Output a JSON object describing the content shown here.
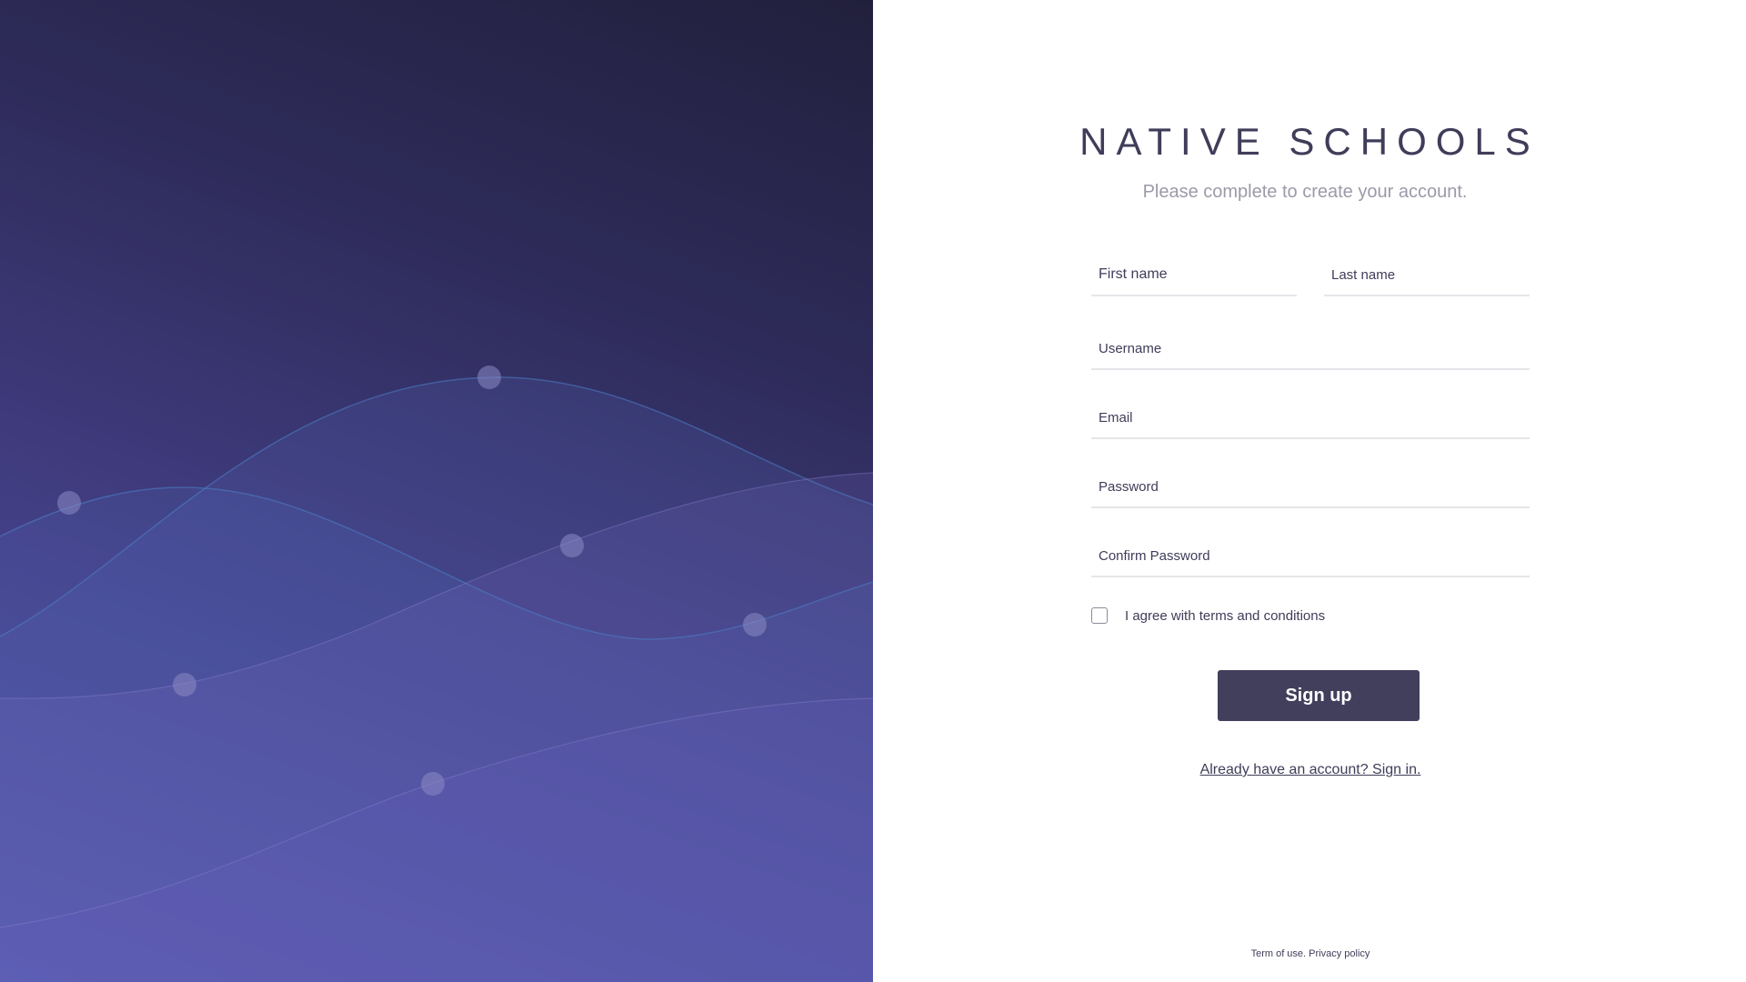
{
  "brand": {
    "title": "NATIVE SCHOOLS",
    "subtitle": "Please complete to create your account."
  },
  "form": {
    "first_name_placeholder": "First name",
    "last_name_placeholder": "Last name",
    "username_placeholder": "Username",
    "email_placeholder": "Email",
    "password_placeholder": "Password",
    "confirm_password_placeholder": "Confirm Password",
    "agree_label": "I agree with terms and conditions",
    "agree_checked": false,
    "signup_label": "Sign up",
    "signin_link": "Already have an account? Sign in."
  },
  "footer": {
    "terms": "Term of use.",
    "privacy": "Privacy policy"
  },
  "colors": {
    "accent": "#413f5b",
    "hero_dark": "#21203c",
    "hero_light": "#5552a6",
    "subtitle": "#9c9aa8"
  }
}
